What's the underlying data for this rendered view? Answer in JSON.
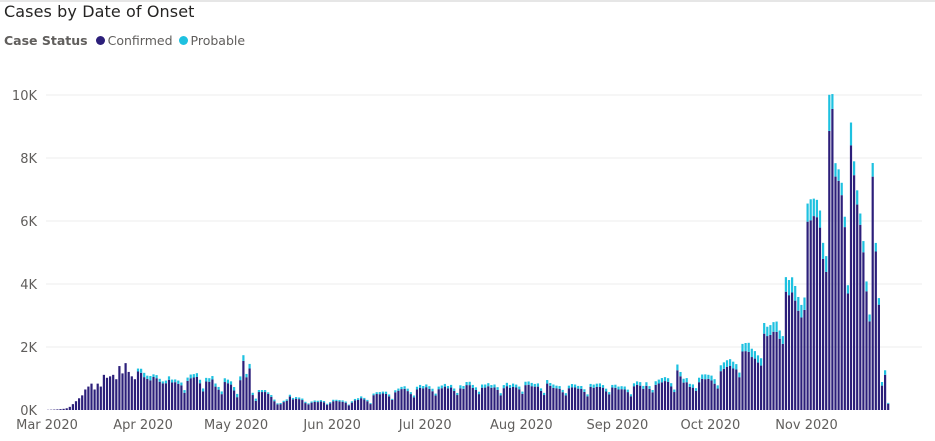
{
  "title": "Cases by Date of Onset",
  "legend": {
    "title": "Case Status",
    "items": [
      {
        "label": "Confirmed",
        "color": "#2c1f7a"
      },
      {
        "label": "Probable",
        "color": "#1ec1e0"
      }
    ]
  },
  "chart_data": {
    "type": "bar",
    "stacked": true,
    "x_axis": {
      "ticks": [
        {
          "label": "Mar 2020",
          "day": 0
        },
        {
          "label": "Apr 2020",
          "day": 31
        },
        {
          "label": "May 2020",
          "day": 61
        },
        {
          "label": "Jun 2020",
          "day": 92
        },
        {
          "label": "Jul 2020",
          "day": 122
        },
        {
          "label": "Aug 2020",
          "day": 153
        },
        {
          "label": "Sep 2020",
          "day": 184
        },
        {
          "label": "Oct 2020",
          "day": 214
        },
        {
          "label": "Nov 2020",
          "day": 245
        }
      ]
    },
    "y_axis": {
      "ylim": [
        0,
        10000
      ],
      "ticks": [
        {
          "label": "0K",
          "value": 0
        },
        {
          "label": "2K",
          "value": 2000
        },
        {
          "label": "4K",
          "value": 4000
        },
        {
          "label": "6K",
          "value": 6000
        },
        {
          "label": "8K",
          "value": 8000
        },
        {
          "label": "10K",
          "value": 10000
        }
      ]
    },
    "grid": "horizontal",
    "series": [
      {
        "name": "Confirmed",
        "color": "#2c1f7a",
        "values": [
          6,
          10,
          14,
          19,
          28,
          37,
          55,
          100,
          186,
          279,
          372,
          465,
          651,
          744,
          837,
          651,
          837,
          744,
          1116,
          1023,
          1069,
          1116,
          977,
          1395,
          1162,
          1488,
          1209,
          1069,
          977,
          1223,
          1181,
          1043,
          986,
          943,
          1048,
          1010,
          897,
          845,
          850,
          959,
          872,
          883,
          831,
          782,
          548,
          923,
          1009,
          1033,
          1051,
          850,
          589,
          904,
          897,
          969,
          743,
          646,
          503,
          888,
          850,
          806,
          618,
          407,
          948,
          1558,
          1040,
          1317,
          475,
          290,
          570,
          570,
          570,
          510,
          417,
          280,
          178,
          186,
          251,
          294,
          427,
          338,
          360,
          345,
          316,
          220,
          177,
          234,
          257,
          251,
          268,
          246,
          167,
          215,
          278,
          285,
          271,
          261,
          232,
          149,
          234,
          303,
          321,
          376,
          335,
          279,
          188,
          471,
          507,
          502,
          524,
          510,
          434,
          321,
          563,
          613,
          664,
          673,
          600,
          505,
          403,
          653,
          704,
          685,
          725,
          668,
          596,
          459,
          661,
          691,
          742,
          688,
          712,
          603,
          475,
          688,
          673,
          791,
          790,
          700,
          636,
          504,
          708,
          712,
          755,
          705,
          718,
          639,
          461,
          694,
          756,
          706,
          731,
          714,
          658,
          515,
          790,
          802,
          756,
          741,
          742,
          609,
          475,
          839,
          766,
          700,
          691,
          668,
          564,
          465,
          691,
          720,
          716,
          678,
          671,
          575,
          434,
          731,
          707,
          734,
          732,
          707,
          588,
          498,
          713,
          702,
          651,
          661,
          652,
          568,
          436,
          755,
          800,
          773,
          673,
          769,
          672,
          559,
          798,
          841,
          878,
          918,
          891,
          746,
          570,
          1261,
          1070,
          870,
          882,
          734,
          709,
          610,
          882,
          987,
          979,
          989,
          937,
          836,
          681,
          1232,
          1305,
          1370,
          1397,
          1318,
          1285,
          1042,
          1857,
          1869,
          1846,
          1681,
          1632,
          1506,
          1410,
          2423,
          2347,
          2384,
          2485,
          2481,
          2262,
          2100,
          3755,
          3645,
          3732,
          3472,
          3152,
          2939,
          3178,
          5979,
          6021,
          6156,
          6121,
          5790,
          4800,
          4383,
          8859,
          9558,
          7410,
          7276,
          6820,
          5806,
          3698,
          8402,
          7454,
          6522,
          5880,
          5007,
          3768,
          2813,
          7408,
          5032,
          3343,
          774,
          1117,
          197
        ]
      },
      {
        "name": "Probable",
        "color": "#1ec1e0",
        "values": [
          0,
          0,
          0,
          0,
          0,
          0,
          0,
          0,
          0,
          0,
          0,
          0,
          0,
          0,
          0,
          0,
          0,
          0,
          0,
          0,
          0,
          0,
          0,
          0,
          0,
          0,
          0,
          0,
          0,
          93,
          129,
          137,
          104,
          137,
          84,
          98,
          93,
          63,
          85,
          110,
          94,
          87,
          104,
          90,
          84,
          106,
          117,
          106,
          118,
          110,
          95,
          116,
          113,
          109,
          98,
          86,
          87,
          119,
          114,
          104,
          111,
          104,
          119,
          182,
          105,
          146,
          72,
          72,
          64,
          64,
          64,
          51,
          57,
          51,
          33,
          36,
          42,
          44,
          57,
          45,
          51,
          52,
          48,
          41,
          33,
          36,
          45,
          43,
          45,
          41,
          30,
          36,
          47,
          40,
          45,
          44,
          37,
          23,
          43,
          48,
          53,
          56,
          49,
          42,
          31,
          51,
          57,
          67,
          60,
          72,
          59,
          33,
          63,
          68,
          70,
          81,
          78,
          62,
          58,
          85,
          92,
          77,
          86,
          88,
          79,
          61,
          82,
          87,
          86,
          75,
          85,
          80,
          66,
          97,
          90,
          98,
          106,
          96,
          83,
          77,
          101,
          98,
          97,
          87,
          92,
          86,
          72,
          97,
          107,
          89,
          107,
          92,
          86,
          69,
          107,
          104,
          104,
          87,
          102,
          78,
          70,
          113,
          92,
          109,
          82,
          92,
          74,
          69,
          82,
          104,
          93,
          86,
          91,
          83,
          63,
          97,
          100,
          102,
          112,
          84,
          89,
          70,
          83,
          101,
          93,
          95,
          94,
          79,
          63,
          93,
          108,
          112,
          92,
          113,
          86,
          77,
          115,
          124,
          136,
          125,
          119,
          106,
          80,
          183,
          137,
          122,
          131,
          97,
          104,
          84,
          143,
          140,
          152,
          128,
          155,
          142,
          102,
          188,
          207,
          210,
          217,
          216,
          172,
          146,
          241,
          258,
          287,
          265,
          238,
          229,
          233,
          339,
          296,
          311,
          305,
          327,
          262,
          246,
          463,
          481,
          481,
          465,
          436,
          397,
          393,
          575,
          669,
          554,
          550,
          543,
          506,
          502,
          1148,
          472,
          426,
          364,
          393,
          330,
          263,
          724,
          441,
          452,
          358,
          356,
          313,
          219,
          433,
          272,
          210,
          115,
          144,
          29
        ]
      }
    ]
  }
}
